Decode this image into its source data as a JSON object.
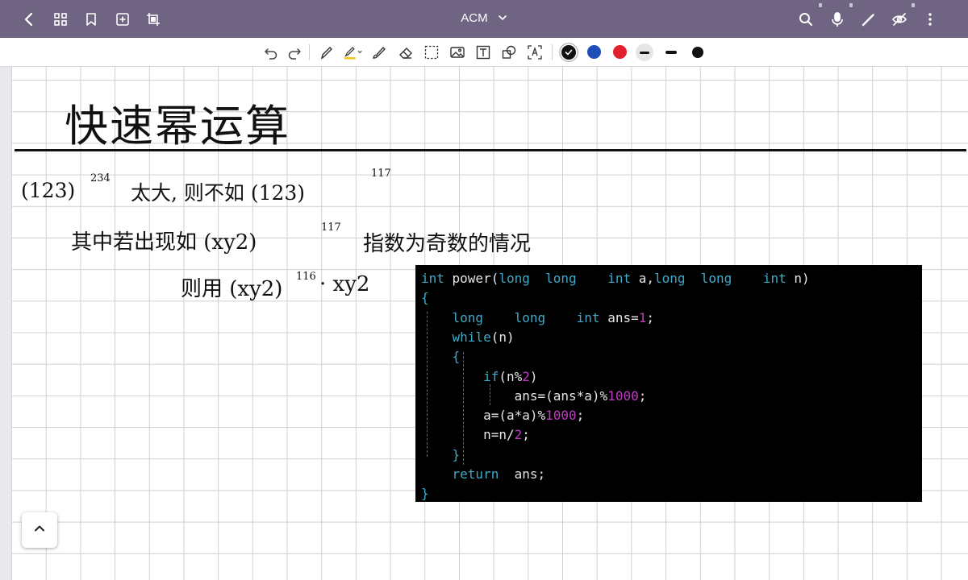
{
  "app": {
    "notebook_title": "ACM"
  },
  "topbar": {
    "left_icons": [
      "back-icon",
      "grid-icon",
      "bookmark-icon",
      "add-page-icon",
      "crop-icon"
    ],
    "right_icons": [
      "search-icon",
      "microphone-icon",
      "pen-icon",
      "hide-icon",
      "more-icon"
    ],
    "bar_color": "#6f6582"
  },
  "toolbar": {
    "tools": [
      "undo-icon",
      "redo-icon",
      "pencil-icon",
      "highlighter-icon",
      "brush-icon",
      "eraser-icon",
      "lasso-select-icon",
      "image-icon",
      "text-box-icon",
      "shape-icon",
      "text-recognition-icon"
    ],
    "colors": [
      "#111111",
      "#1f4fb6",
      "#e0202c"
    ],
    "selected_color": "#111111"
  },
  "note": {
    "heading": "快速幂运算",
    "line1_base": "(123)",
    "line1_exp": "234",
    "line1_mid": "太大, 则不如 (123)",
    "line1_exp2": "117",
    "line2_text": "其中若出现如 (xy2)",
    "line2_exp": "117",
    "line2_tail": "指数为奇数的情况",
    "line3_text": "则用 (xy2)",
    "line3_exp": "116",
    "line3_tail": "· xy2"
  },
  "code": {
    "lines": [
      [
        {
          "t": "int ",
          "c": "kw"
        },
        {
          "t": "power(",
          "c": "tx"
        },
        {
          "t": "long  long    int ",
          "c": "kw"
        },
        {
          "t": "a,",
          "c": "tx"
        },
        {
          "t": "long  long    int ",
          "c": "kw"
        },
        {
          "t": "n)",
          "c": "tx"
        }
      ],
      [
        {
          "t": "{",
          "c": "kw"
        }
      ],
      [
        {
          "t": "    long    long    int ",
          "c": "kw"
        },
        {
          "t": "ans=",
          "c": "tx"
        },
        {
          "t": "1",
          "c": "nm"
        },
        {
          "t": ";",
          "c": "tx"
        }
      ],
      [
        {
          "t": "    while",
          "c": "kw"
        },
        {
          "t": "(n)",
          "c": "tx"
        }
      ],
      [
        {
          "t": "    {",
          "c": "kw"
        }
      ],
      [
        {
          "t": "        if",
          "c": "kw"
        },
        {
          "t": "(n%",
          "c": "tx"
        },
        {
          "t": "2",
          "c": "nm"
        },
        {
          "t": ")",
          "c": "tx"
        }
      ],
      [
        {
          "t": "            ans=(ans*a)%",
          "c": "tx"
        },
        {
          "t": "1000",
          "c": "nm"
        },
        {
          "t": ";",
          "c": "tx"
        }
      ],
      [
        {
          "t": "        a=(a*a)%",
          "c": "tx"
        },
        {
          "t": "1000",
          "c": "nm"
        },
        {
          "t": ";",
          "c": "tx"
        }
      ],
      [
        {
          "t": "        n=n/",
          "c": "tx"
        },
        {
          "t": "2",
          "c": "nm"
        },
        {
          "t": ";",
          "c": "tx"
        }
      ],
      [
        {
          "t": "    }",
          "c": "kw"
        }
      ],
      [
        {
          "t": "    return  ",
          "c": "kw"
        },
        {
          "t": "ans;",
          "c": "tx"
        }
      ],
      [
        {
          "t": "}",
          "c": "kw"
        }
      ]
    ]
  },
  "fab": {
    "icon": "chevron-up-icon"
  }
}
